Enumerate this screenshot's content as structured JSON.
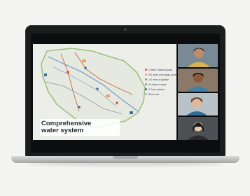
{
  "slide": {
    "title_line1": "Comprehensive",
    "title_line2": "water system"
  },
  "legend": {
    "items": [
      {
        "label": "1 Water Treatment plant",
        "color": "#e0562b"
      },
      {
        "label": "600 acres of recharge ponds",
        "color": "#f0a35e"
      },
      {
        "label": "100 miles of pipeline",
        "color": "#7b8fa4"
      },
      {
        "label": "51 miles of canals",
        "color": "#7b8fa4"
      },
      {
        "label": "5 Pump stations",
        "color": "#3f6ca8"
      },
      {
        "label": "Reservoirs",
        "color": "#9fb6cf"
      }
    ]
  },
  "participants": [
    {
      "name": "",
      "bg": "#7a8a94",
      "skin": "#c08d6b",
      "hair": "#2a2522",
      "shirt": "#d8b44a"
    },
    {
      "name": "",
      "bg": "#8b7868",
      "skin": "#8a5a3c",
      "hair": "#1c1714",
      "shirt": "#3f7fa8"
    },
    {
      "name": "",
      "bg": "#b9c2c7",
      "skin": "#e2b89a",
      "hair": "#6a4a32",
      "shirt": "#2f6b93"
    },
    {
      "name": "",
      "bg": "#4d5054",
      "skin": "#e7c6ac",
      "hair": "#1e1a18",
      "shirt": "#2b2b2b"
    }
  ]
}
